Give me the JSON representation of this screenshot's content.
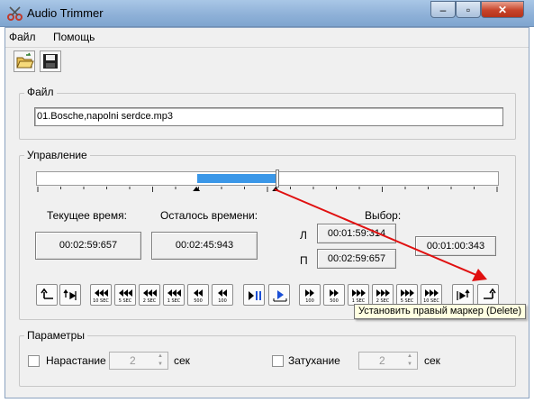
{
  "window": {
    "title": "Audio Trimmer"
  },
  "menu": [
    "Файл",
    "Помощь"
  ],
  "toolbar": {
    "open_icon": "open-folder-icon",
    "save_icon": "save-icon"
  },
  "file_group": {
    "legend": "Файл",
    "filename": "01.Bosche,napolni serdce.mp3"
  },
  "control_group": {
    "legend": "Управление",
    "current_time_label": "Текущее время:",
    "current_time": "00:02:59:657",
    "remaining_label": "Осталось времени:",
    "remaining": "00:02:45:943",
    "selection_label": "Выбор:",
    "left_marker_label": "Л",
    "left_marker": "00:01:59:314",
    "right_marker_label": "П",
    "right_marker": "00:02:59:657",
    "selection_length": "00:01:00:343",
    "buttons": [
      {
        "icon": "set-left-marker-icon",
        "label": ""
      },
      {
        "icon": "go-to-left-marker-icon",
        "label": ""
      },
      {
        "icon": "rewind-10sec-icon",
        "label": "10 SEC"
      },
      {
        "icon": "rewind-5sec-icon",
        "label": "5 SEC"
      },
      {
        "icon": "rewind-2sec-icon",
        "label": "2 SEC"
      },
      {
        "icon": "rewind-1sec-icon",
        "label": "1 SEC"
      },
      {
        "icon": "rewind-500-icon",
        "label": "500"
      },
      {
        "icon": "rewind-100-icon",
        "label": "100"
      },
      {
        "icon": "play-pause-icon",
        "label": ""
      },
      {
        "icon": "play-selection-icon",
        "label": ""
      },
      {
        "icon": "forward-100-icon",
        "label": "100"
      },
      {
        "icon": "forward-500-icon",
        "label": "500"
      },
      {
        "icon": "forward-1sec-icon",
        "label": "1 SEC"
      },
      {
        "icon": "forward-2sec-icon",
        "label": "2 SEC"
      },
      {
        "icon": "forward-5sec-icon",
        "label": "5 SEC"
      },
      {
        "icon": "forward-10sec-icon",
        "label": "10 SEC"
      },
      {
        "icon": "go-to-right-marker-icon",
        "label": ""
      },
      {
        "icon": "set-right-marker-icon",
        "label": ""
      }
    ],
    "tooltip": "Установить правый маркер (Delete)",
    "progress": {
      "selection_start_fraction": 0.348,
      "selection_end_fraction": 0.52,
      "position_fraction": 0.52
    },
    "annotation_color": "#e01010",
    "selection_color": "#3a97e8"
  },
  "params_group": {
    "legend": "Параметры",
    "fade_in_label": "Нарастание",
    "fade_in_value": "2",
    "fade_in_unit": "сек",
    "fade_out_label": "Затухание",
    "fade_out_value": "2",
    "fade_out_unit": "сек"
  }
}
